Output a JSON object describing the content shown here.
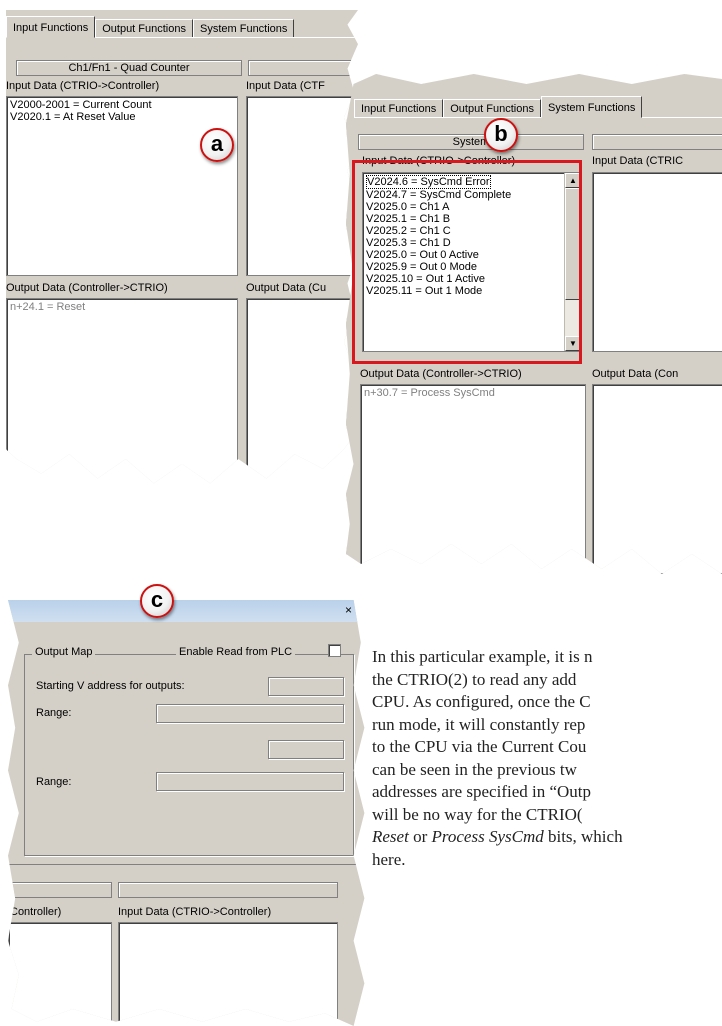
{
  "panel_a": {
    "tabs": [
      "Input Functions",
      "Output Functions",
      "System Functions"
    ],
    "group_title": "Ch1/Fn1 - Quad Counter",
    "input_label": "Input Data (CTRIO->Controller)",
    "input_label_cut": "Input Data (CTF",
    "input_rows": [
      "V2000-2001 = Current Count",
      "V2020.1 = At Reset Value"
    ],
    "output_label": "Output Data (Controller->CTRIO)",
    "output_label_cut": "Output Data (Cu",
    "output_rows": [
      "n+24.1 = Reset"
    ],
    "callout": "a"
  },
  "panel_b": {
    "tabs": [
      "Input Functions",
      "Output Functions",
      "System Functions"
    ],
    "group_title": "System",
    "input_label": "Input Data (CTRIO->Controller)",
    "input_label_cut": "Input Data (CTRIC",
    "input_rows": [
      "V2024.6 = SysCmd Error",
      "V2024.7 = SysCmd Complete",
      "V2025.0 = Ch1 A",
      "V2025.1 = Ch1 B",
      "V2025.2 = Ch1 C",
      "V2025.3 = Ch1 D",
      "V2025.0 = Out 0 Active",
      "V2025.9 = Out 0 Mode",
      "V2025.10 = Out 1 Active",
      "V2025.11 = Out 1 Mode"
    ],
    "output_label": "Output Data (Controller->CTRIO)",
    "output_label_cut": "Output Data (Con",
    "output_rows": [
      "n+30.7 = Process SysCmd"
    ],
    "callout": "b"
  },
  "panel_c": {
    "close_glyph": "×",
    "group_title": "Output Map",
    "checkbox_label": "Enable Read from PLC",
    "start_label": "Starting V address for outputs:",
    "range_label_1": "Range:",
    "range_label_2": "Range:",
    "input_label_cut": "Controller)",
    "input_label": "Input Data (CTRIO->Controller)",
    "callout": "c"
  },
  "paragraph": {
    "line1": "In this particular example, it is n",
    "line2": "the CTRIO(2) to read any add",
    "line3": "CPU.  As configured, once the C",
    "line4": "run mode, it will constantly rep",
    "line5": "to the CPU via the Current Cou",
    "line6": "can be seen in the previous tw",
    "line7": "addresses are specified in “Outp",
    "line8": "will be no way for the CTRIO(",
    "line9_reset": "Reset",
    "line9_or": " or ",
    "line9_process": "Process SysCmd",
    "line9_tail": " bits, which",
    "line10": "here."
  },
  "colors": {
    "window_bg": "#d4d0c8",
    "highlight_red": "#d7181f",
    "callout_border": "#cc1111"
  }
}
